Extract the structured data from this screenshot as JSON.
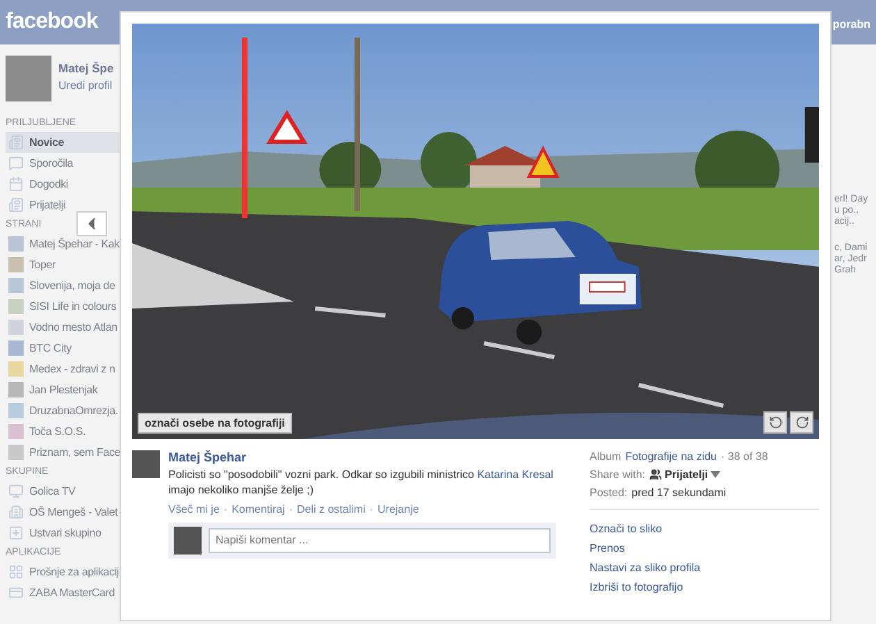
{
  "header": {
    "logo": "facebook",
    "fragment": "porabn"
  },
  "sidebar": {
    "profile": {
      "name": "Matej Špe",
      "link": "Uredi profil"
    },
    "sections": [
      {
        "title": "PRILJUBLJENE",
        "items": [
          {
            "label": "Novice",
            "selected": true
          },
          {
            "label": "Sporočila",
            "selected": false
          },
          {
            "label": "Dogodki",
            "selected": false
          },
          {
            "label": "Prijatelji",
            "selected": false
          }
        ]
      },
      {
        "title": "STRANI",
        "items": [
          {
            "label": "Matej Špehar - Kak",
            "selected": false
          },
          {
            "label": "Toper",
            "selected": false
          },
          {
            "label": "Slovenija, moja de",
            "selected": false
          },
          {
            "label": "SISI Life in colours",
            "selected": false
          },
          {
            "label": "Vodno mesto Atlan",
            "selected": false
          },
          {
            "label": "BTC City",
            "selected": false
          },
          {
            "label": "Medex - zdravi z n",
            "selected": false
          },
          {
            "label": "Jan Plestenjak",
            "selected": false
          },
          {
            "label": "DruzabnaOmrezja.",
            "selected": false
          },
          {
            "label": "Toča S.O.S.",
            "selected": false
          },
          {
            "label": "Priznam, sem Face",
            "selected": false
          }
        ]
      },
      {
        "title": "SKUPINE",
        "items": [
          {
            "label": "Golica TV",
            "selected": false
          },
          {
            "label": "OŠ Mengeš - Valet",
            "selected": false
          },
          {
            "label": "Ustvari skupino",
            "selected": false
          }
        ]
      },
      {
        "title": "APLIKACIJE",
        "items": [
          {
            "label": "Prošnje za aplikacij",
            "selected": false
          },
          {
            "label": "ZABA MasterCard",
            "selected": false
          }
        ]
      }
    ]
  },
  "right_fragments": [
    [
      "erl! Day",
      "u po..",
      "acij.."
    ],
    [
      "c, Dami",
      "ar, Jedr",
      "Grah"
    ]
  ],
  "viewer": {
    "photo": {
      "tag_button": "označi osebe na fotografiji"
    },
    "post": {
      "author": "Matej Špehar",
      "text_before": "Policisti so \"posodobili\" vozni park. Odkar so izgubili ministrico ",
      "link": "Katarina Kresal",
      "text_after": " imajo nekoliko manjše želje ;)",
      "actions": [
        "Všeč mi je",
        "Komentiraj",
        "Deli z ostalimi",
        "Urejanje"
      ],
      "separator": "·",
      "comment": {
        "placeholder": "Napiši komentar ..."
      }
    },
    "details": {
      "album_label": "Album",
      "album": "Fotografije na zidu",
      "count": "· 38 of 38",
      "share_label": "Share with:",
      "share_value": "Prijatelji",
      "posted_label": "Posted:",
      "posted_value": "pred 17 sekundami"
    },
    "actions": [
      "Označi to sliko",
      "Prenos",
      "Nastavi za sliko profila",
      "Izbriši to fotografijo"
    ]
  }
}
